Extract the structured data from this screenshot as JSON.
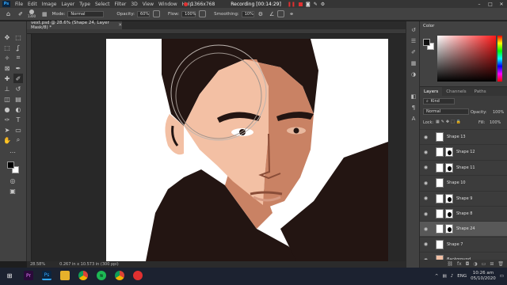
{
  "menu": {
    "items": [
      "File",
      "Edit",
      "Image",
      "Layer",
      "Type",
      "Select",
      "Filter",
      "3D",
      "View",
      "Window",
      "Help"
    ],
    "app_logo": "Ps"
  },
  "recorder": {
    "resolution": "1366x768",
    "status": "Recording [00:14:29]"
  },
  "options_bar": {
    "brush_size": "1300",
    "mode_label": "Mode:",
    "mode_value": "Normal",
    "opacity_label": "Opacity:",
    "opacity_value": "60%",
    "flow_label": "Flow:",
    "flow_value": "100%",
    "smoothing_label": "Smoothing:",
    "smoothing_value": "10%"
  },
  "document": {
    "tab_title": "vext.psd @ 28.6% (Shape 24, Layer Mask/8) *",
    "zoom": "28.58%",
    "doc_info": "0.267 in x 10.573 in (300 ppi)"
  },
  "color_panel": {
    "title": "Color"
  },
  "layers_panel": {
    "tabs": [
      "Layers",
      "Channels",
      "Paths"
    ],
    "kind_filter": "Kind",
    "blend_mode": "Normal",
    "opacity_label": "Opacity:",
    "opacity_value": "100%",
    "lock_label": "Lock:",
    "fill_label": "Fill:",
    "fill_value": "100%",
    "layers": [
      {
        "name": "Shape 13",
        "has_mask": false,
        "selected": false,
        "italic": false
      },
      {
        "name": "Shape 12",
        "has_mask": true,
        "selected": false,
        "italic": false
      },
      {
        "name": "Shape 11",
        "has_mask": true,
        "selected": false,
        "italic": false
      },
      {
        "name": "Shape 10",
        "has_mask": false,
        "selected": false,
        "italic": false
      },
      {
        "name": "Shape 9",
        "has_mask": true,
        "selected": false,
        "italic": false
      },
      {
        "name": "Shape 8",
        "has_mask": true,
        "selected": false,
        "italic": false
      },
      {
        "name": "Shape 24",
        "has_mask": true,
        "selected": true,
        "italic": false
      },
      {
        "name": "Shape 7",
        "has_mask": false,
        "selected": false,
        "italic": false
      },
      {
        "name": "Background",
        "has_mask": false,
        "selected": false,
        "italic": true
      }
    ]
  },
  "taskbar": {
    "time": "10:26 am",
    "date": "05/10/2020",
    "language": "ENG",
    "apps": [
      "Premiere Pro",
      "Photoshop",
      "File Explorer",
      "Chrome",
      "Spotify",
      "Chrome",
      "Recorder"
    ]
  },
  "colors": {
    "skin_light": "#f3c0a4",
    "skin_shadow": "#c98264",
    "hair": "#231512",
    "accent_blue": "#31a8ff"
  }
}
